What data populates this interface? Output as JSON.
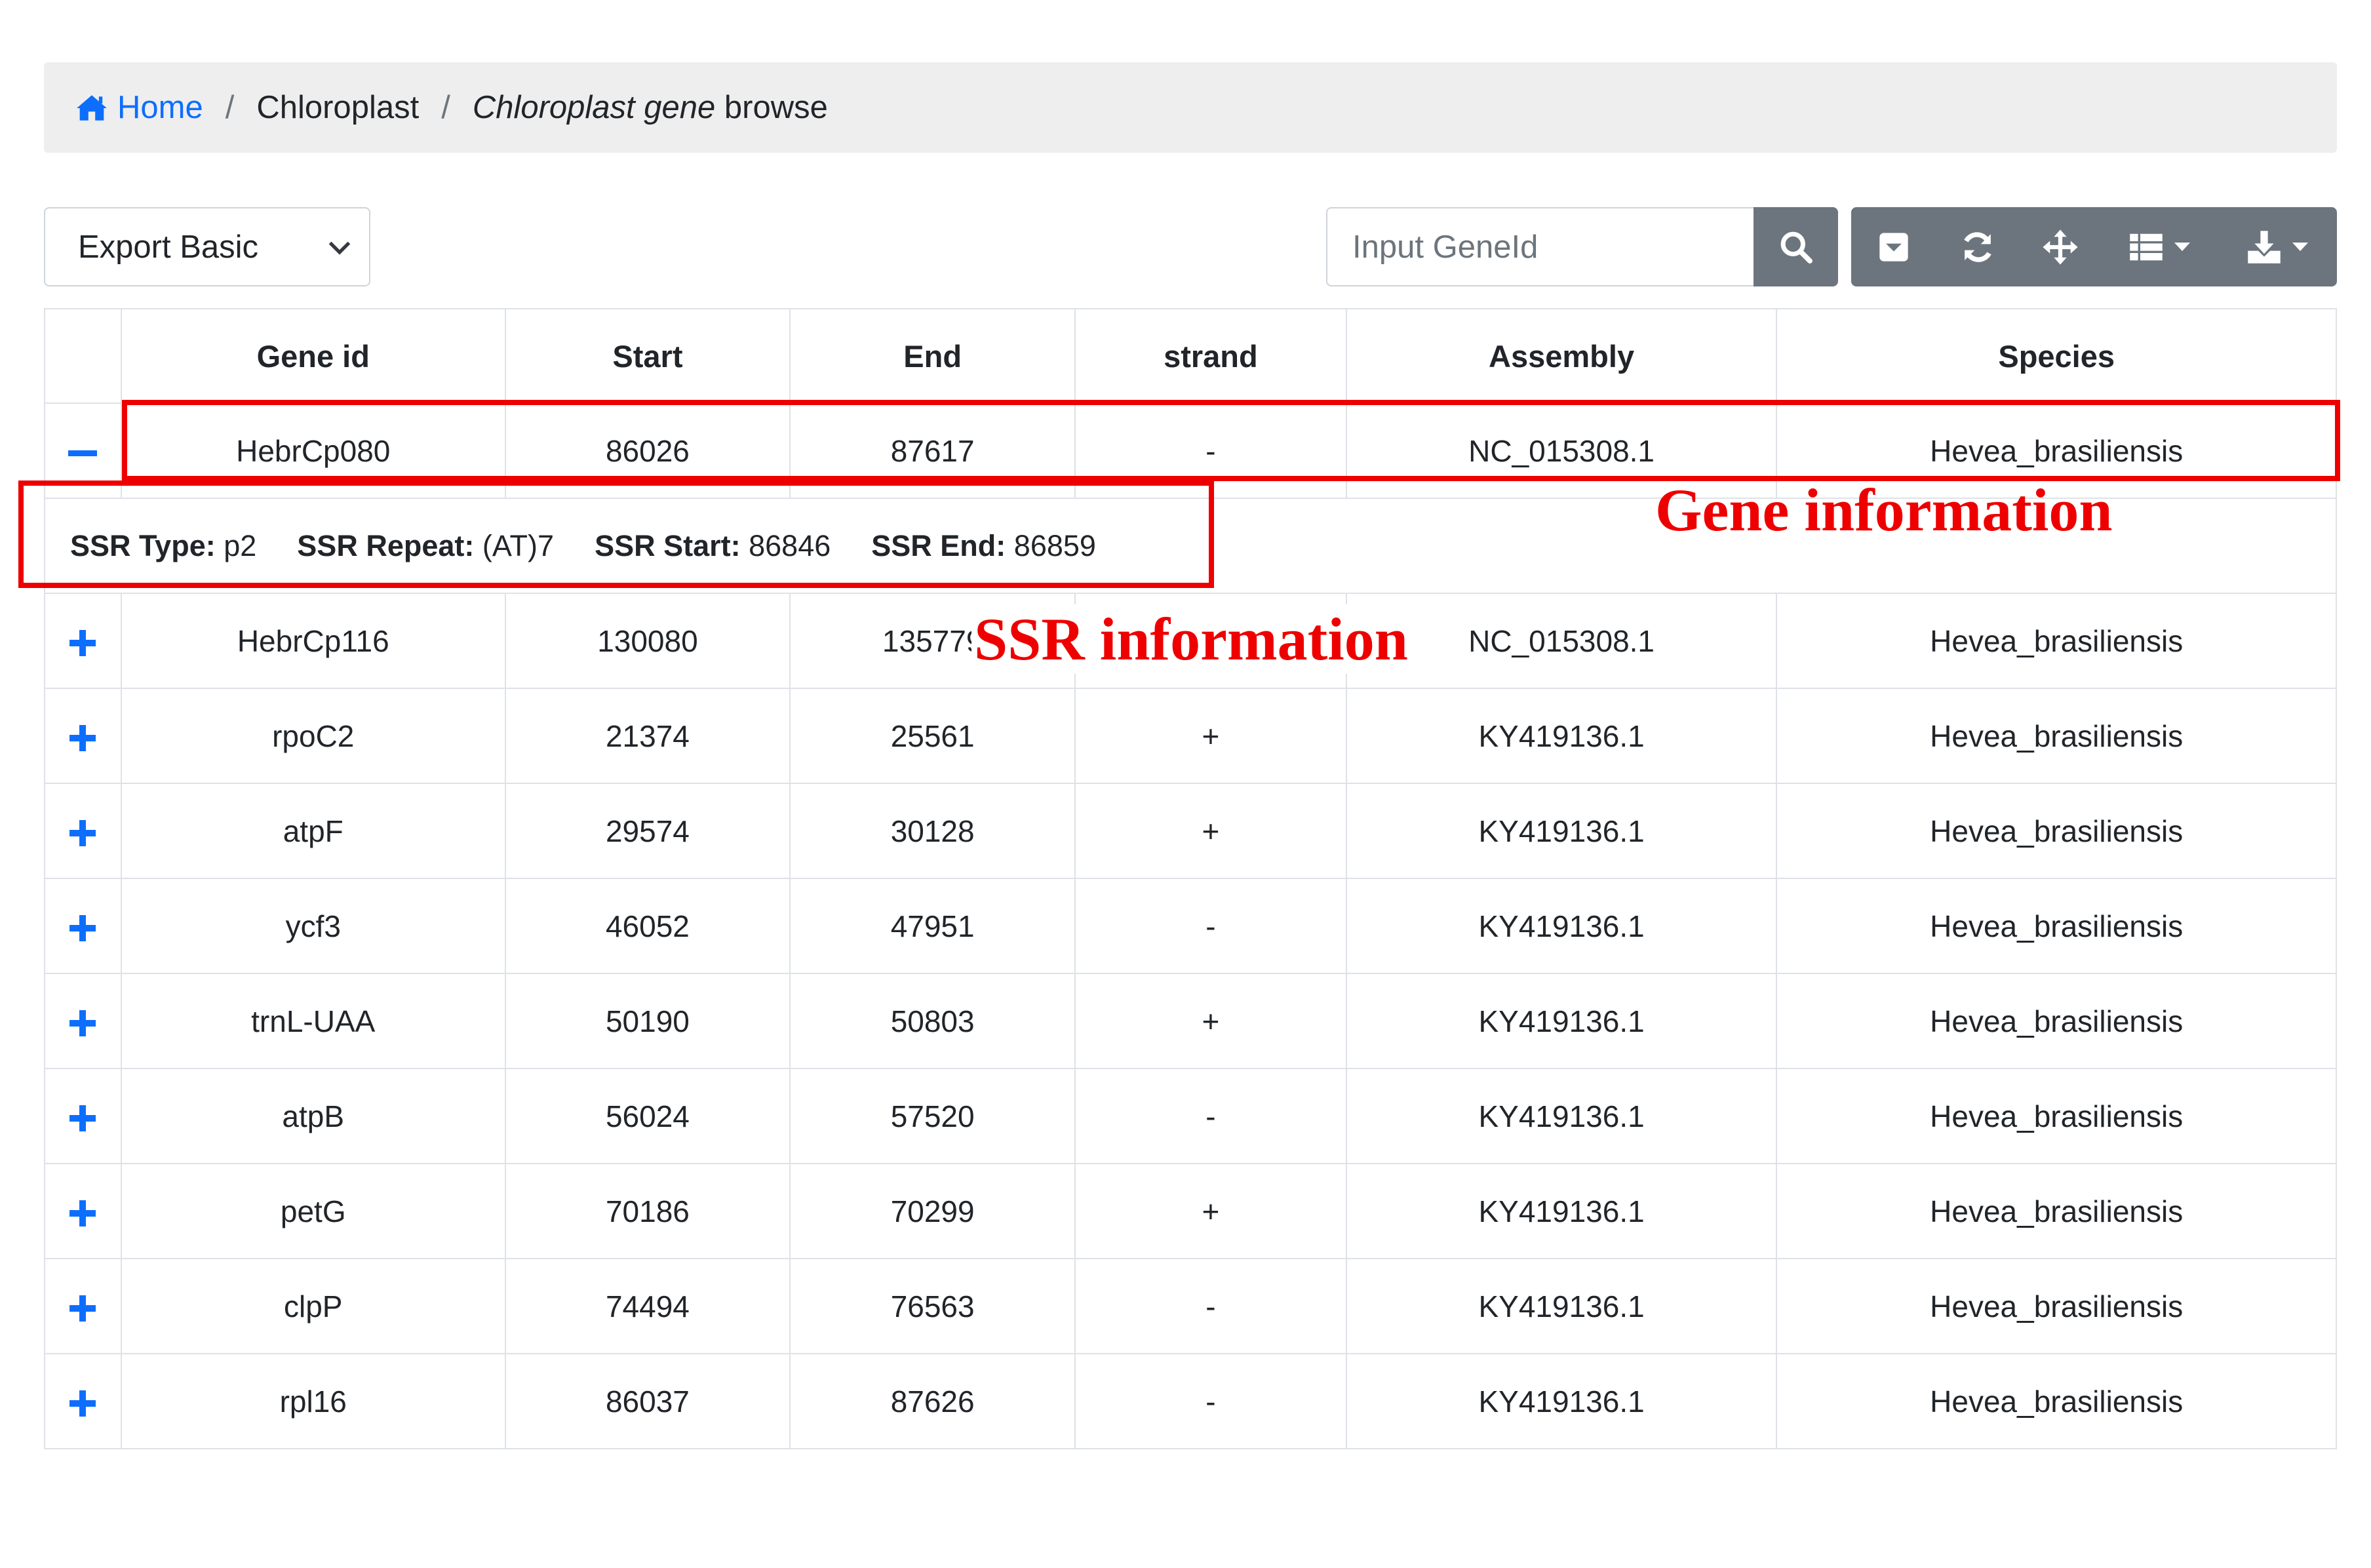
{
  "breadcrumb": {
    "home": "Home",
    "separator": "/",
    "level2": "Chloroplast",
    "current_italic": "Chloroplast gene",
    "current_rest": " browse"
  },
  "toolbar": {
    "export_select": "Export Basic",
    "search_placeholder": "Input GeneId",
    "icons": [
      "search-icon",
      "toggle-icon",
      "refresh-icon",
      "fullscreen-icon",
      "columns-icon",
      "download-icon"
    ]
  },
  "table": {
    "headers": [
      "Gene id",
      "Start",
      "End",
      "strand",
      "Assembly",
      "Species"
    ],
    "rows": [
      {
        "gene_id": "HebrCp080",
        "start": "86026",
        "end": "87617",
        "strand": "-",
        "assembly": "NC_015308.1",
        "species": "Hevea_brasiliensis",
        "expanded": true
      },
      {
        "gene_id": "HebrCp116",
        "start": "130080",
        "end": "135779",
        "strand": "",
        "assembly": "NC_015308.1",
        "species": "Hevea_brasiliensis",
        "expanded": false
      },
      {
        "gene_id": "rpoC2",
        "start": "21374",
        "end": "25561",
        "strand": "+",
        "assembly": "KY419136.1",
        "species": "Hevea_brasiliensis",
        "expanded": false
      },
      {
        "gene_id": "atpF",
        "start": "29574",
        "end": "30128",
        "strand": "+",
        "assembly": "KY419136.1",
        "species": "Hevea_brasiliensis",
        "expanded": false
      },
      {
        "gene_id": "ycf3",
        "start": "46052",
        "end": "47951",
        "strand": "-",
        "assembly": "KY419136.1",
        "species": "Hevea_brasiliensis",
        "expanded": false
      },
      {
        "gene_id": "trnL-UAA",
        "start": "50190",
        "end": "50803",
        "strand": "+",
        "assembly": "KY419136.1",
        "species": "Hevea_brasiliensis",
        "expanded": false
      },
      {
        "gene_id": "atpB",
        "start": "56024",
        "end": "57520",
        "strand": "-",
        "assembly": "KY419136.1",
        "species": "Hevea_brasiliensis",
        "expanded": false
      },
      {
        "gene_id": "petG",
        "start": "70186",
        "end": "70299",
        "strand": "+",
        "assembly": "KY419136.1",
        "species": "Hevea_brasiliensis",
        "expanded": false
      },
      {
        "gene_id": "clpP",
        "start": "74494",
        "end": "76563",
        "strand": "-",
        "assembly": "KY419136.1",
        "species": "Hevea_brasiliensis",
        "expanded": false
      },
      {
        "gene_id": "rpl16",
        "start": "86037",
        "end": "87626",
        "strand": "-",
        "assembly": "KY419136.1",
        "species": "Hevea_brasiliensis",
        "expanded": false
      }
    ],
    "detail": {
      "ssr_type_label": "SSR Type:",
      "ssr_type": "p2",
      "ssr_repeat_label": "SSR Repeat:",
      "ssr_repeat": "(AT)7",
      "ssr_start_label": "SSR Start:",
      "ssr_start": "86846",
      "ssr_end_label": "SSR End:",
      "ssr_end": "86859"
    }
  },
  "annotations": {
    "gene_info": "Gene information",
    "ssr_info": "SSR information",
    "color": "#ee0000"
  },
  "colors": {
    "accent": "#0d6efd",
    "button_gray": "#6c757d",
    "breadcrumb_bg": "#eeeeee"
  }
}
